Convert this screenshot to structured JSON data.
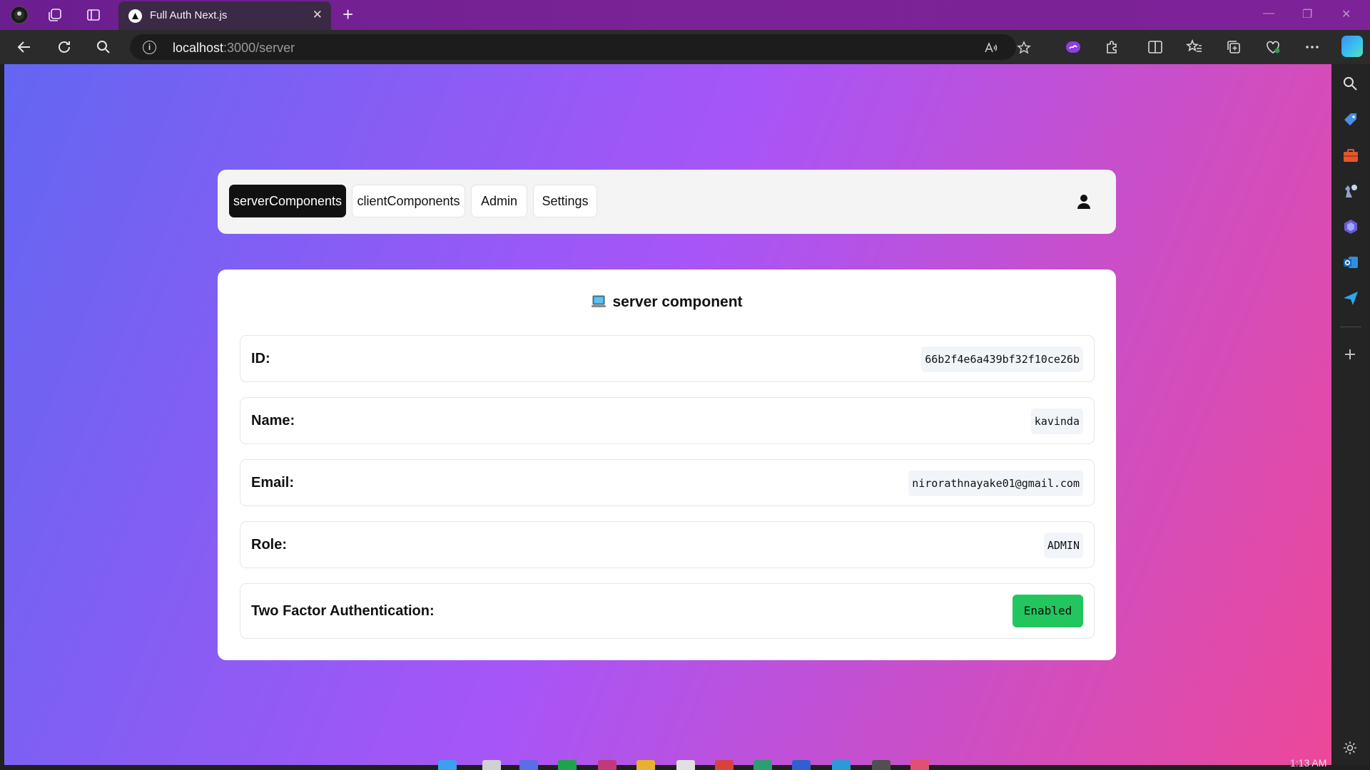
{
  "browser": {
    "tab_title": "Full Auth Next.js",
    "tab_close": "✕",
    "new_tab": "+",
    "address": {
      "host": "localhost",
      "path": ":3000/server"
    },
    "window_controls": [
      "—",
      "❐",
      "✕"
    ]
  },
  "nav": {
    "items": [
      {
        "label": "serverComponents",
        "active": true
      },
      {
        "label": "clientComponents",
        "active": false
      },
      {
        "label": "Admin",
        "active": false
      },
      {
        "label": "Settings",
        "active": false
      }
    ]
  },
  "card": {
    "title": "server component",
    "rows": [
      {
        "label": "ID:",
        "value": "66b2f4e6a439bf32f10ce26b"
      },
      {
        "label": "Name:",
        "value": "kavinda"
      },
      {
        "label": "Email:",
        "value": "nirorathnayake01@gmail.com"
      },
      {
        "label": "Role:",
        "value": "ADMIN"
      },
      {
        "label": "Two Factor Authentication:",
        "value": "Enabled"
      }
    ]
  },
  "taskbar": {
    "clock": "1:13 AM",
    "badge_count": "1"
  },
  "colors": {
    "gradient_start": "#6366f1",
    "gradient_mid": "#a855f7",
    "gradient_end": "#ec4899",
    "enabled_badge": "#22c55e",
    "active_nav": "#111111"
  }
}
